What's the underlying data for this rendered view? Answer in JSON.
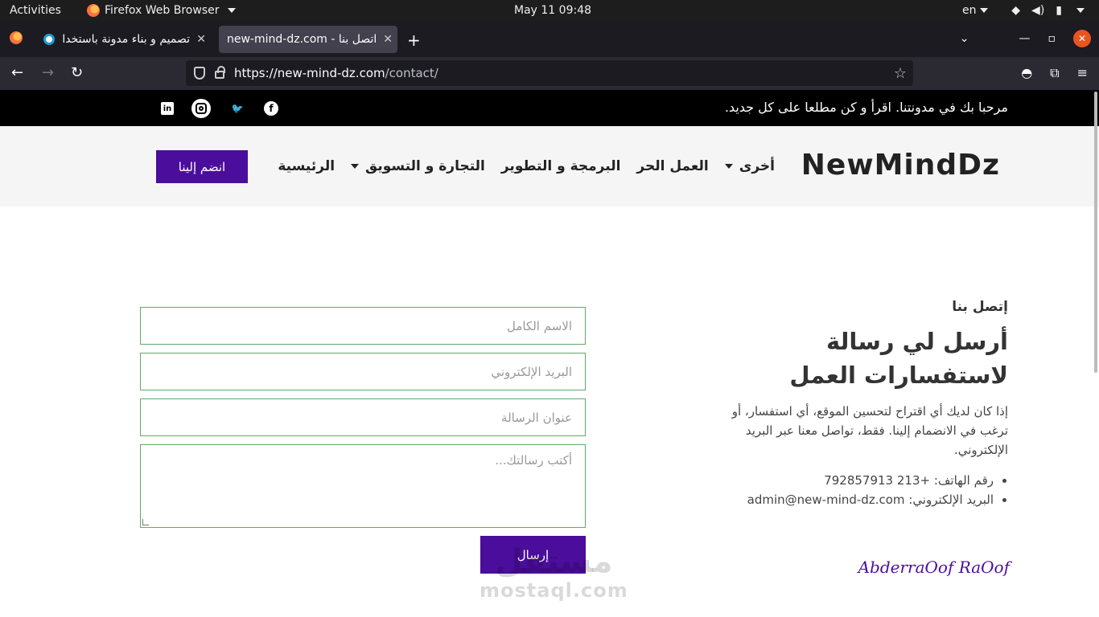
{
  "system": {
    "activities": "Activities",
    "app_name": "Firefox Web Browser",
    "clock": "May 11  09:48",
    "lang": "en"
  },
  "browser": {
    "tabs": [
      {
        "title": "تصميم و بناء مدونة باستخدا"
      },
      {
        "title": "اتصل بنا - new-mind-dz.com"
      }
    ],
    "url_host": "https://new-mind-dz.com",
    "url_path": "/contact/"
  },
  "site": {
    "welcome": "مرحبا بك في مدونتنا. اقرأ و كن مطلعا على كل جديد.",
    "social_icons": [
      "linkedin-icon",
      "instagram-icon",
      "twitter-icon",
      "facebook-icon"
    ],
    "logo": "NewMindDz",
    "menu": [
      {
        "label": "الرئيسية"
      },
      {
        "label": "التجارة و التسويق"
      },
      {
        "label": "البرمجة و التطوير"
      },
      {
        "label": "العمل الحر"
      },
      {
        "label": "أخرى"
      }
    ],
    "join_label": "انضم إلينا"
  },
  "contact": {
    "kicker": "إتصل بنا",
    "heading": "أرسل لي رسالة لاستفسارات العمل",
    "description": "إذا كان لديك أي اقتراح لتحسين الموقع، أي استفسار، أو ترغب في الانضمام إلينا. فقط، تواصل معنا عبر البريد الإلكتروني.",
    "phone": "رقم الهاتف: +213 792857913",
    "email": "البريد الإلكتروني: admin@new-mind-dz.com",
    "signature": "AbderraOof RaOof"
  },
  "form": {
    "name_placeholder": "الاسم الكامل",
    "email_placeholder": "البريد الإلكتروني",
    "subject_placeholder": "عنوان الرسالة",
    "message_placeholder": "أكتب رسالتك...",
    "submit_label": "إرسال"
  },
  "watermark": {
    "arabic": "مستقل",
    "latin": "mostaql.com"
  },
  "colors": {
    "brand_purple": "#4b0d9c",
    "field_border": "#62a86a"
  }
}
